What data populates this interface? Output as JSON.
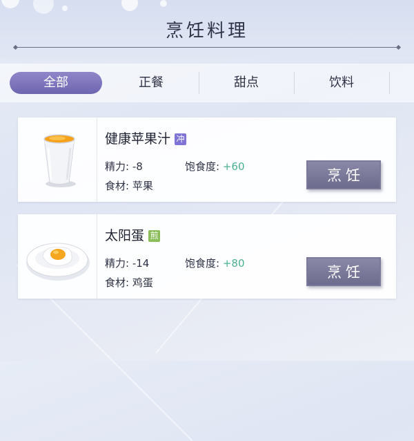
{
  "header": {
    "title": "烹饪料理"
  },
  "tabs": [
    {
      "label": "全部",
      "active": true
    },
    {
      "label": "正餐",
      "active": false
    },
    {
      "label": "甜点",
      "active": false
    },
    {
      "label": "饮料",
      "active": false
    }
  ],
  "recipes": [
    {
      "name": "健康苹果汁",
      "tag": "冲",
      "tag_color": "#7f74d6",
      "image_icon": "juice-cup-icon",
      "energy_label": "精力:",
      "energy_value": "-8",
      "satiety_label": "饱食度:",
      "satiety_value": "+60",
      "ingredients_label": "食材:",
      "ingredients_value": "苹果",
      "button_label": "烹饪"
    },
    {
      "name": "太阳蛋",
      "tag": "煎",
      "tag_color": "#8bbd5a",
      "image_icon": "fried-egg-icon",
      "energy_label": "精力:",
      "energy_value": "-14",
      "satiety_label": "饱食度:",
      "satiety_value": "+80",
      "ingredients_label": "食材:",
      "ingredients_value": "鸡蛋",
      "button_label": "烹饪"
    }
  ],
  "colors": {
    "accent": "#7f74d6",
    "positive": "#4ab090",
    "button": "#6c6a8c"
  }
}
